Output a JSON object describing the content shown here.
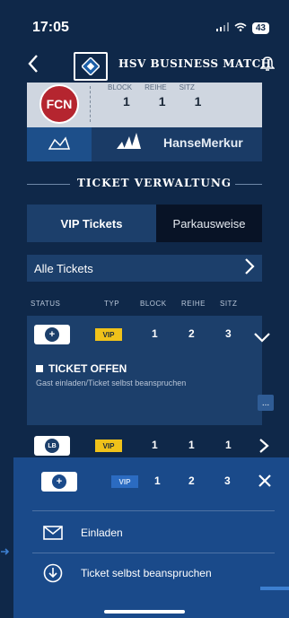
{
  "status_bar": {
    "time": "17:05",
    "signal": "..ll",
    "wifi": "wifi",
    "battery": "43"
  },
  "header": {
    "title": "HSV BUSINESS MATCH",
    "icons": [
      "back-arrow-icon",
      "hsv-logo-icon",
      "bell-icon"
    ]
  },
  "ticket_card": {
    "club_logo_text": "FCN",
    "headers": [
      "BLOCK",
      "REIHE",
      "SITZ"
    ],
    "values": [
      "1",
      "1",
      "1"
    ],
    "sponsor": "HanseMerkur"
  },
  "section_title": "TICKET VERWALTUNG",
  "tabs": [
    {
      "label": "VIP Tickets",
      "active": true
    },
    {
      "label": "Parkausweise",
      "active": false
    }
  ],
  "filter": {
    "label": "Alle Tickets"
  },
  "columns": [
    "STATUS",
    "TYP",
    "BLOCK",
    "REIHE",
    "SITZ"
  ],
  "tickets": [
    {
      "type": "VIP",
      "block": "1",
      "reihe": "2",
      "sitz": "3",
      "expanded": true,
      "status_title": "TICKET OFFEN",
      "status_sub": "Gast einladen/Ticket selbst beanspruchen",
      "more": "..."
    },
    {
      "type": "VIP",
      "block": "1",
      "reihe": "1",
      "sitz": "1",
      "logo": "LB"
    }
  ],
  "sheet": {
    "type": "VIP",
    "block": "1",
    "reihe": "2",
    "sitz": "3",
    "items": [
      {
        "label": "Einladen",
        "icon": "mail-icon"
      },
      {
        "label": "Ticket selbst beanspruchen",
        "icon": "download-circle-icon"
      }
    ]
  },
  "colors": {
    "background": "#0f2849",
    "panel": "#1c3f6b",
    "sheet": "#1a4a8a",
    "vip_badge": "#f0c21a"
  }
}
